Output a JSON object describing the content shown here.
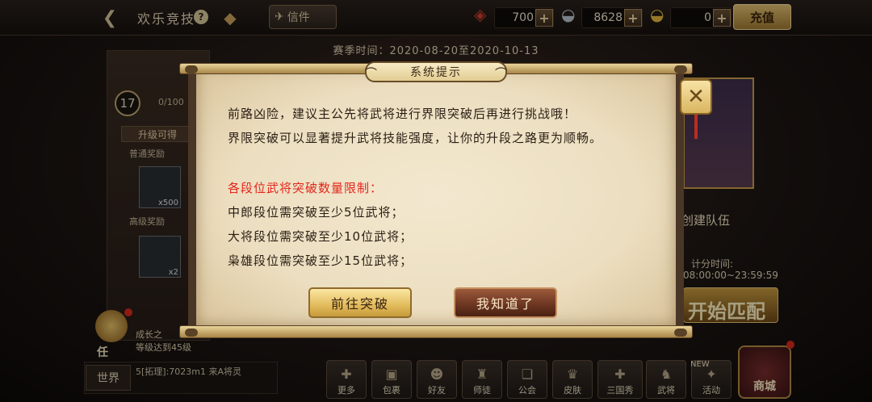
{
  "topbar": {
    "mode_title": "欢乐竞技",
    "mail_label": "信件",
    "resources": [
      {
        "icon": "token-icon",
        "value": "700"
      },
      {
        "icon": "silver-ingot-icon",
        "value": "8628"
      },
      {
        "icon": "gold-ingot-icon",
        "value": "0"
      }
    ],
    "recharge_label": "充值"
  },
  "season": {
    "text": "赛季时间：2020-08-20至2020-10-13"
  },
  "left_panel": {
    "rank": "17",
    "progress": "0/100",
    "upgrade_tab": "升级可得",
    "normal_reward_label": "普通奖励",
    "normal_reward_count": "x500",
    "advanced_reward_label": "高级奖励",
    "advanced_reward_count": "x2"
  },
  "right_panel": {
    "team_label": "创建队伍",
    "time_title": "计分时间:",
    "time_value": "08:00:00~23:59:59",
    "match_label": "开始匹配"
  },
  "task": {
    "label": "任务",
    "line1": "成长之",
    "line2": "等级达到45级"
  },
  "chat": {
    "world_label": "世界",
    "message": "5[拓理]:7023m1 来A将灵"
  },
  "bottom_nav": [
    {
      "label": "更多",
      "icon": "plus-icon"
    },
    {
      "label": "包裹",
      "icon": "bag-icon"
    },
    {
      "label": "好友",
      "icon": "friends-icon"
    },
    {
      "label": "师徒",
      "icon": "mentor-icon"
    },
    {
      "label": "公会",
      "icon": "guild-icon"
    },
    {
      "label": "皮肤",
      "icon": "skin-icon"
    },
    {
      "label": "三国秀",
      "icon": "show-icon"
    },
    {
      "label": "武将",
      "icon": "general-icon"
    },
    {
      "label": "活动",
      "icon": "activity-icon"
    }
  ],
  "new_tag": "NEW",
  "shop_label": "商城",
  "dialog": {
    "title": "系统提示",
    "line1": "前路凶险，建议主公先将武将进行界限突破后再进行挑战哦！",
    "line2": "界限突破可以显著提升武将技能强度，让你的升段之路更为顺畅。",
    "limit_heading": "各段位武将突破数量限制：",
    "limits": [
      "中郎段位需突破至少5位武将；",
      "大将段位需突破至少10位武将；",
      "枭雄段位需突破至少15位武将；"
    ],
    "go_button": "前往突破",
    "ok_button": "我知道了"
  }
}
